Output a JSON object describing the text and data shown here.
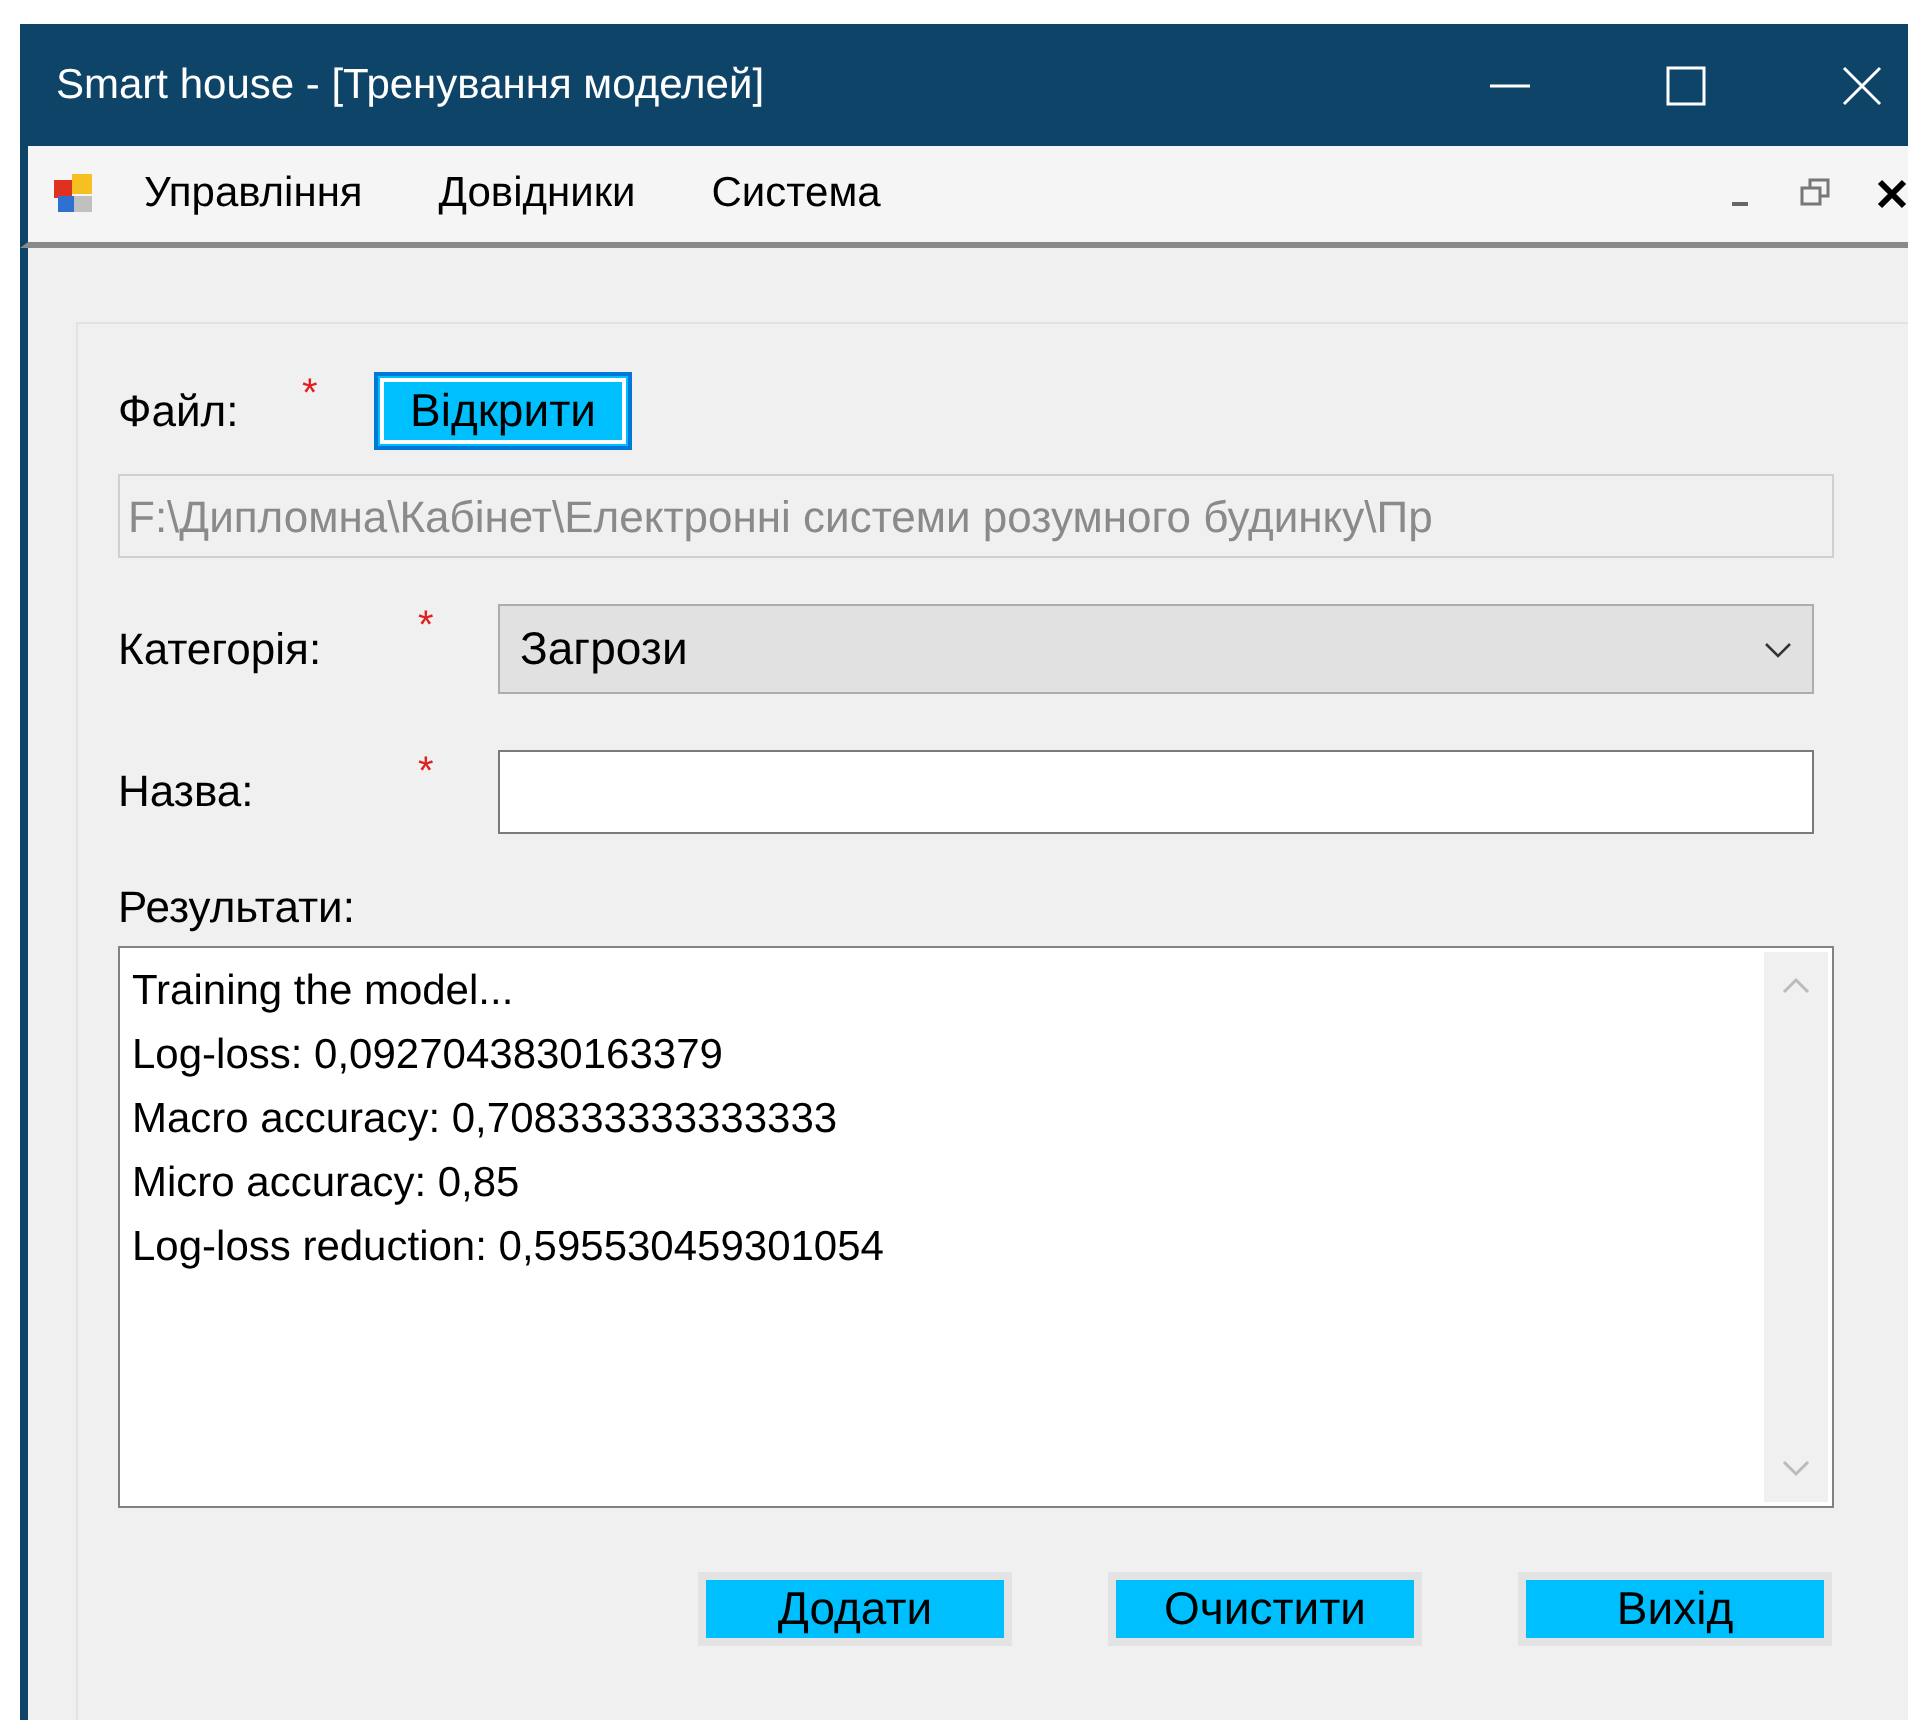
{
  "window": {
    "title": "Smart house - [Тренування моделей]"
  },
  "menu": [
    "Управління",
    "Довідники",
    "Система"
  ],
  "form": {
    "file_label": "Файл:",
    "required_mark": "*",
    "open_button": {
      "label": "Відкрити",
      "focused": true
    },
    "file_path": "F:\\Дипломна\\Кабінет\\Електронні системи розумного будинку\\Пр",
    "category_label": "Категорія:",
    "category_value": "Загрози",
    "name_label": "Назва:",
    "results_label": "Результати:",
    "results": [
      "Training the model...",
      "Log-loss: 0,0927043830163379",
      "Macro accuracy: 0,708333333333333",
      "Micro accuracy: 0,85",
      "Log-loss reduction: 0,595530459301054"
    ]
  },
  "buttons": [
    {
      "label": "Додати",
      "focused": false
    },
    {
      "label": "Очистити",
      "focused": false
    },
    {
      "label": "Вихід",
      "focused": false
    }
  ]
}
